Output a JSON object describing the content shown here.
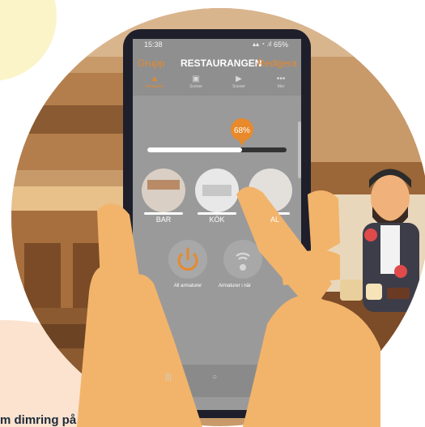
{
  "status_bar": {
    "time": "15:38",
    "battery": "65%"
  },
  "header": {
    "left_label": "Grupp",
    "title": "RESTAURANGEN",
    "right_label": "Redigera"
  },
  "tabs": [
    {
      "label": "Armaturer",
      "icon": "lamp-icon"
    },
    {
      "label": "Scener",
      "icon": "image-icon"
    },
    {
      "label": "Scener",
      "icon": "play-icon"
    },
    {
      "label": "Mer",
      "icon": "more-icon"
    }
  ],
  "dimmer": {
    "value_label": "68%",
    "level": 0.68
  },
  "groups": [
    {
      "label": "BAR"
    },
    {
      "label": "KÖK"
    },
    {
      "label": "AL"
    }
  ],
  "actions": [
    {
      "label": "All armaturer",
      "icon": "power-icon"
    },
    {
      "label": "Armaturer i när",
      "icon": "proximity-icon"
    }
  ],
  "caption": {
    "text": "m dimring på"
  },
  "colors": {
    "accent": "#e8892b",
    "screen": "#9a9a9a",
    "skin": "#f2b46b",
    "bg_wall": "#c89a6a"
  }
}
